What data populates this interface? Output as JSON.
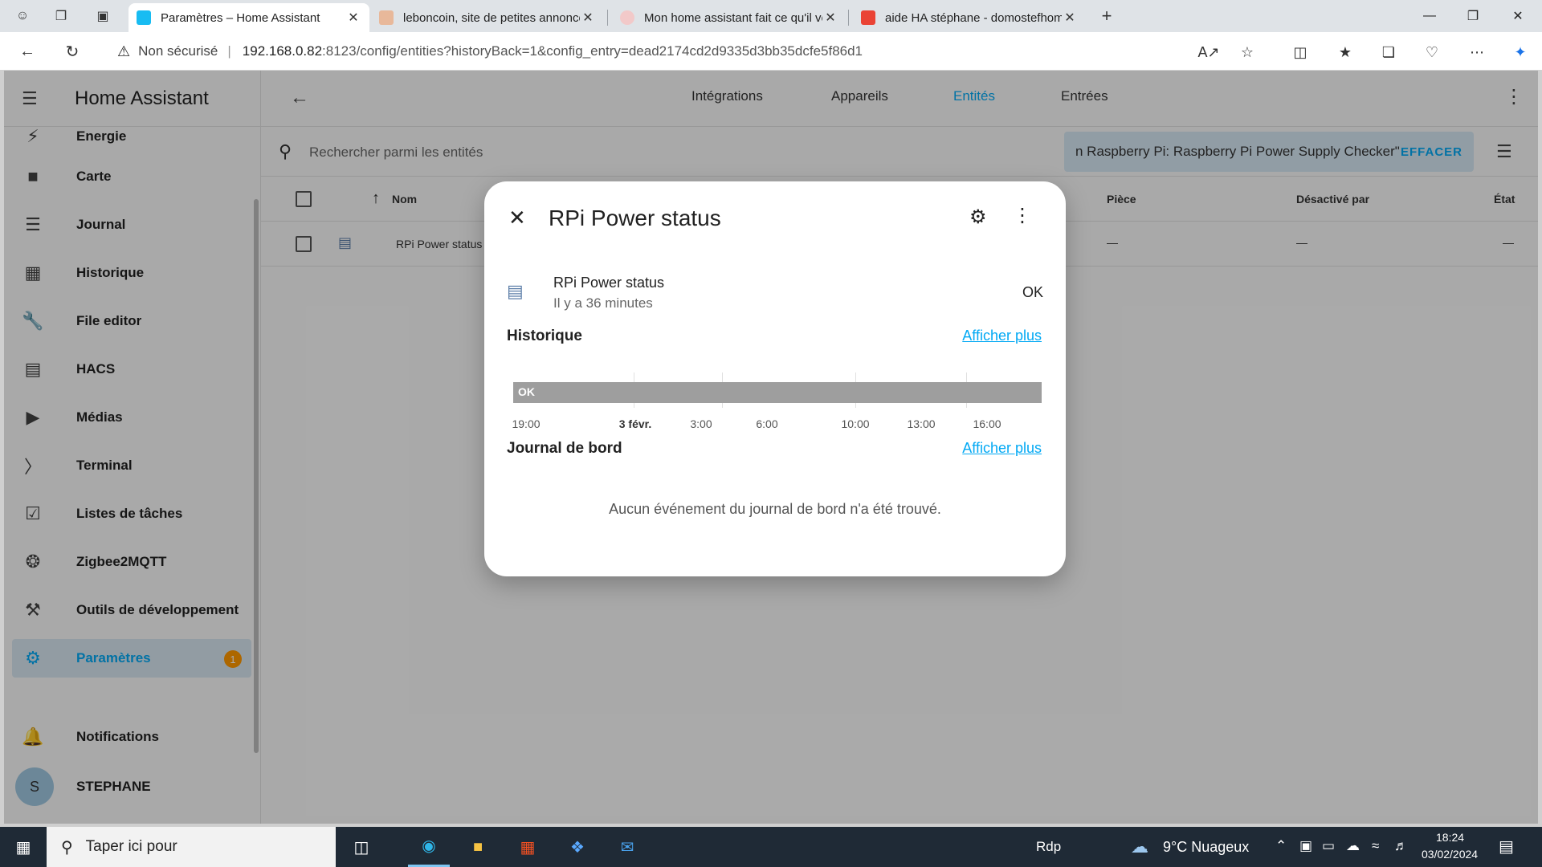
{
  "browser": {
    "tabs": [
      {
        "title": "Paramètres – Home Assistant",
        "active": true
      },
      {
        "title": "leboncoin, site de petites annonces",
        "active": false
      },
      {
        "title": "Mon home assistant fait ce qu'il veut",
        "active": false
      },
      {
        "title": "aide HA stéphane - domostefhom",
        "active": false
      }
    ],
    "security_label": "Non sécurisé",
    "url_host": "192.168.0.82",
    "url_path": ":8123/config/entities?historyBack=1&config_entry=dead2174cd2d9335d3bb35dcfe5f86d1"
  },
  "sidebar": {
    "title": "Home Assistant",
    "items": [
      {
        "label": "Energie",
        "icon": "lightning-icon"
      },
      {
        "label": "Carte",
        "icon": "map-person-icon"
      },
      {
        "label": "Journal",
        "icon": "list-icon"
      },
      {
        "label": "Historique",
        "icon": "bar-chart-icon"
      },
      {
        "label": "File editor",
        "icon": "wrench-icon"
      },
      {
        "label": "HACS",
        "icon": "hacs-icon"
      },
      {
        "label": "Médias",
        "icon": "media-icon"
      },
      {
        "label": "Terminal",
        "icon": "terminal-icon"
      },
      {
        "label": "Listes de tâches",
        "icon": "clipboard-icon"
      },
      {
        "label": "Zigbee2MQTT",
        "icon": "zigbee-icon"
      },
      {
        "label": "Outils de développement",
        "icon": "hammer-icon"
      },
      {
        "label": "Paramètres",
        "icon": "gear-icon",
        "badge": "1"
      }
    ],
    "notifications_label": "Notifications",
    "user_initial": "S",
    "user_name": "STEPHANE"
  },
  "header": {
    "tabs": [
      "Intégrations",
      "Appareils",
      "Entités",
      "Entrées"
    ],
    "active_tab": "Entités"
  },
  "search": {
    "placeholder": "Rechercher parmi les entités",
    "filter_text": "n Raspberry Pi: Raspberry Pi Power Supply Checker\"",
    "clear_label": "EFFACER"
  },
  "table": {
    "columns": [
      "Nom",
      "Pièce",
      "Désactivé par",
      "État"
    ],
    "rows": [
      {
        "name": "RPi Power status",
        "piece": "—",
        "disabled_by": "—",
        "state": "—"
      }
    ]
  },
  "dialog": {
    "title": "RPi Power status",
    "entity_name": "RPi Power status",
    "last_changed": "Il y a 36 minutes",
    "state": "OK",
    "history_title": "Historique",
    "show_more": "Afficher plus",
    "timeline_state": "OK",
    "timeline_ticks": [
      "19:00",
      "3 févr.",
      "3:00",
      "6:00",
      "10:00",
      "13:00",
      "16:00"
    ],
    "logbook_title": "Journal de bord",
    "logbook_empty": "Aucun événement du journal de bord n'a été trouvé."
  },
  "taskbar": {
    "search_placeholder": "Taper ici pour",
    "rdp_label": "Rdp",
    "weather": "9°C Nuageux",
    "time": "18:24",
    "date": "03/02/2024"
  }
}
